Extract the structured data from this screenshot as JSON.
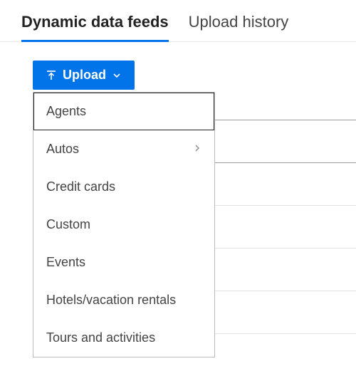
{
  "tabs": {
    "dynamic": "Dynamic data feeds",
    "history": "Upload history"
  },
  "toolbar": {
    "upload_label": "Upload"
  },
  "upload_menu": {
    "items": [
      {
        "label": "Agents",
        "has_submenu": false
      },
      {
        "label": "Autos",
        "has_submenu": true
      },
      {
        "label": "Credit cards",
        "has_submenu": false
      },
      {
        "label": "Custom",
        "has_submenu": false
      },
      {
        "label": "Events",
        "has_submenu": false
      },
      {
        "label": "Hotels/vacation rentals",
        "has_submenu": false
      },
      {
        "label": "Tours and activities",
        "has_submenu": false
      }
    ]
  },
  "colors": {
    "primary": "#0074e8"
  }
}
